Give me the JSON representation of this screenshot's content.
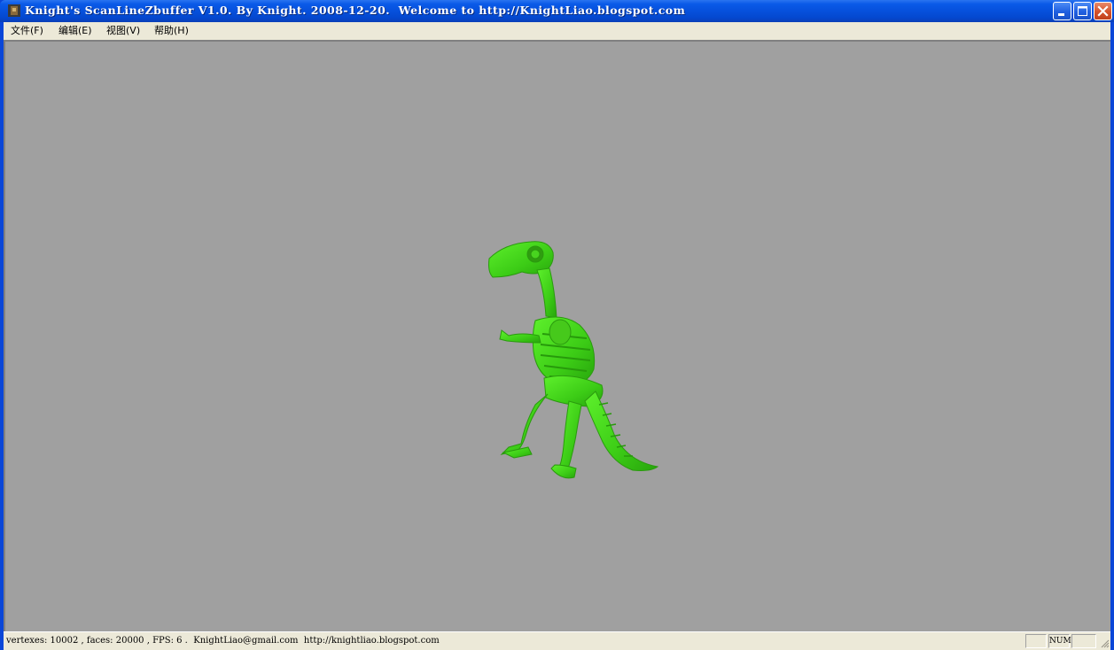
{
  "window": {
    "title": "Knight's ScanLineZbuffer V1.0. By Knight. 2008-12-20.  Welcome to http://KnightLiao.blogspot.com",
    "icon": "app-icon",
    "controls": [
      "minimize-icon",
      "maximize-icon",
      "close-icon"
    ]
  },
  "menu": {
    "items": [
      {
        "label": "文件(F)"
      },
      {
        "label": "编辑(E)"
      },
      {
        "label": "视图(V)"
      },
      {
        "label": "帮助(H)"
      }
    ]
  },
  "viewport": {
    "background": "#a0a0a0",
    "model_color": "#3fd31a",
    "model": "dinosaur-skeleton"
  },
  "statusbar": {
    "text": "vertexes: 10002 , faces: 20000 , FPS: 6 .  KnightLiao@gmail.com  http://knightliao.blogspot.com",
    "indicators": [
      "",
      "NUM",
      ""
    ]
  }
}
